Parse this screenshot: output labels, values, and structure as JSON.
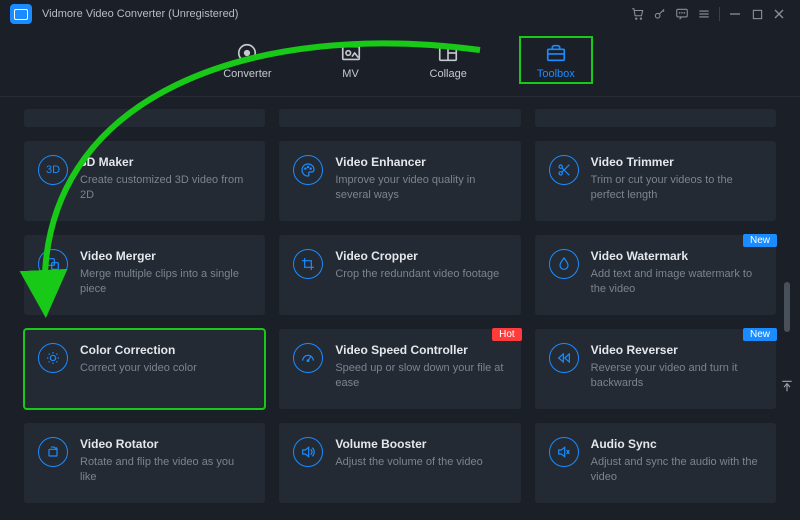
{
  "window": {
    "title": "Vidmore Video Converter (Unregistered)"
  },
  "tabs": {
    "converter": "Converter",
    "mv": "MV",
    "collage": "Collage",
    "toolbox": "Toolbox"
  },
  "badges": {
    "hot": "Hot",
    "new": "New"
  },
  "cards": {
    "threeDMaker": {
      "title": "3D Maker",
      "desc": "Create customized 3D video from 2D"
    },
    "videoEnhancer": {
      "title": "Video Enhancer",
      "desc": "Improve your video quality in several ways"
    },
    "videoTrimmer": {
      "title": "Video Trimmer",
      "desc": "Trim or cut your videos to the perfect length"
    },
    "videoMerger": {
      "title": "Video Merger",
      "desc": "Merge multiple clips into a single piece"
    },
    "videoCropper": {
      "title": "Video Cropper",
      "desc": "Crop the redundant video footage"
    },
    "videoWatermark": {
      "title": "Video Watermark",
      "desc": "Add text and image watermark to the video"
    },
    "colorCorrection": {
      "title": "Color Correction",
      "desc": "Correct your video color"
    },
    "videoSpeed": {
      "title": "Video Speed Controller",
      "desc": "Speed up or slow down your file at ease"
    },
    "videoReverser": {
      "title": "Video Reverser",
      "desc": "Reverse your video and turn it backwards"
    },
    "videoRotator": {
      "title": "Video Rotator",
      "desc": "Rotate and flip the video as you like"
    },
    "volumeBooster": {
      "title": "Volume Booster",
      "desc": "Adjust the volume of the video"
    },
    "audioSync": {
      "title": "Audio Sync",
      "desc": "Adjust and sync the audio with the video"
    }
  }
}
